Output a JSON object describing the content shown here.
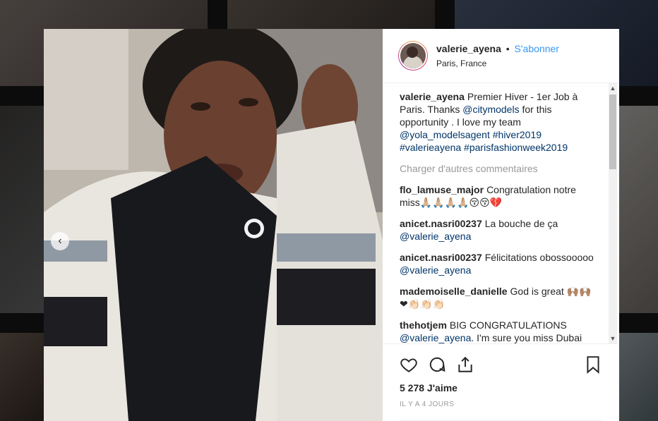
{
  "post": {
    "username": "valerie_ayena",
    "dot": "•",
    "follow_label": "S'abonner",
    "location": "Paris, France",
    "caption_user": "valerie_ayena",
    "caption_text_1": "Premier Hiver - 1er Job à Paris. Thanks ",
    "caption_mention_1": "@citymodels",
    "caption_text_2": " for this opportunity . I love my team ",
    "caption_mention_2": "@yola_modelsagent",
    "caption_tag_1": " #hiver2019",
    "caption_tag_2": "#valerieayena",
    "caption_tag_3": " #parisfashionweek2019",
    "load_more": "Charger d'autres commentaires",
    "likes": "5 278 J'aime",
    "time": "IL Y A 4 JOURS"
  },
  "comments": [
    {
      "user": "flo_lamuse_major",
      "text": "Congratulation notre miss🙏🏼🙏🏼🙏🏼🙏🏼😚😚💔"
    },
    {
      "user": "anicet.nasri00237",
      "text": "La bouche de ça ",
      "mention": "@valerie_ayena"
    },
    {
      "user": "anicet.nasri00237",
      "text": "Félicitations obossooooo ",
      "mention": "@valerie_ayena"
    },
    {
      "user": "mademoiselle_danielle",
      "text": "God is great 🙌🏽🙌🏽❤👏🏻👏🏻👏🏻"
    },
    {
      "user": "thehotjem",
      "text": "BIG CONGRATULATIONS ",
      "mention": "@valerie_ayena",
      "text2": ". I'm sure you miss Dubai but all the friends you have made will only take you further!! Yeaaah now you can"
    }
  ],
  "colors": {
    "link": "#3897f0",
    "mention": "#003569",
    "text": "#262626",
    "muted": "#999999"
  },
  "icons": [
    "heart-icon",
    "comment-icon",
    "share-icon",
    "bookmark-icon",
    "chevron-left-icon"
  ]
}
